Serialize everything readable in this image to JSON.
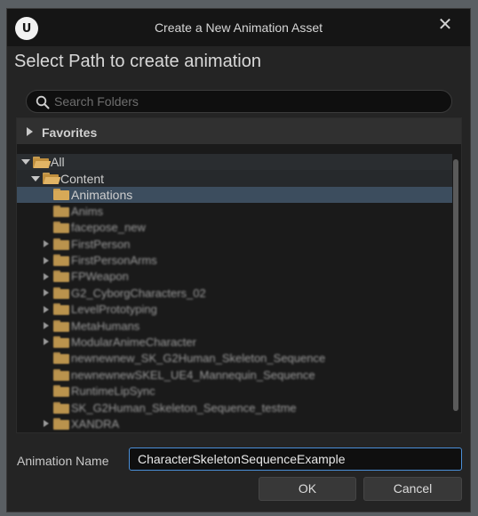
{
  "window": {
    "title": "Create a New Animation Asset",
    "logo_text": "U",
    "close_glyph": "✕"
  },
  "heading": "Select Path to create animation",
  "search": {
    "placeholder": "Search Folders",
    "value": ""
  },
  "favorites": {
    "label": "Favorites"
  },
  "tree": {
    "all_label": "All",
    "content_label": "Content",
    "selected_label": "Animations",
    "folders": [
      {
        "label": "Anims",
        "expandable": false
      },
      {
        "label": "facepose_new",
        "expandable": false
      },
      {
        "label": "FirstPerson",
        "expandable": true
      },
      {
        "label": "FirstPersonArms",
        "expandable": true
      },
      {
        "label": "FPWeapon",
        "expandable": true
      },
      {
        "label": "G2_CyborgCharacters_02",
        "expandable": true
      },
      {
        "label": "LevelPrototyping",
        "expandable": true
      },
      {
        "label": "MetaHumans",
        "expandable": true
      },
      {
        "label": "ModularAnimeCharacter",
        "expandable": true
      },
      {
        "label": "newnewnew_SK_G2Human_Skeleton_Sequence",
        "expandable": false
      },
      {
        "label": "newnewnewSKEL_UE4_Mannequin_Sequence",
        "expandable": false
      },
      {
        "label": "RuntimeLipSync",
        "expandable": false
      },
      {
        "label": "SK_G2Human_Skeleton_Sequence_testme",
        "expandable": false
      },
      {
        "label": "XANDRA",
        "expandable": true
      }
    ]
  },
  "animation_name": {
    "label": "Animation Name",
    "value": "CharacterSkeletonSequenceExample"
  },
  "buttons": {
    "ok": "OK",
    "cancel": "Cancel"
  },
  "colors": {
    "selection": "#3c4d5e",
    "focus_border": "#4a8fd8",
    "folder": "#d7a957"
  }
}
